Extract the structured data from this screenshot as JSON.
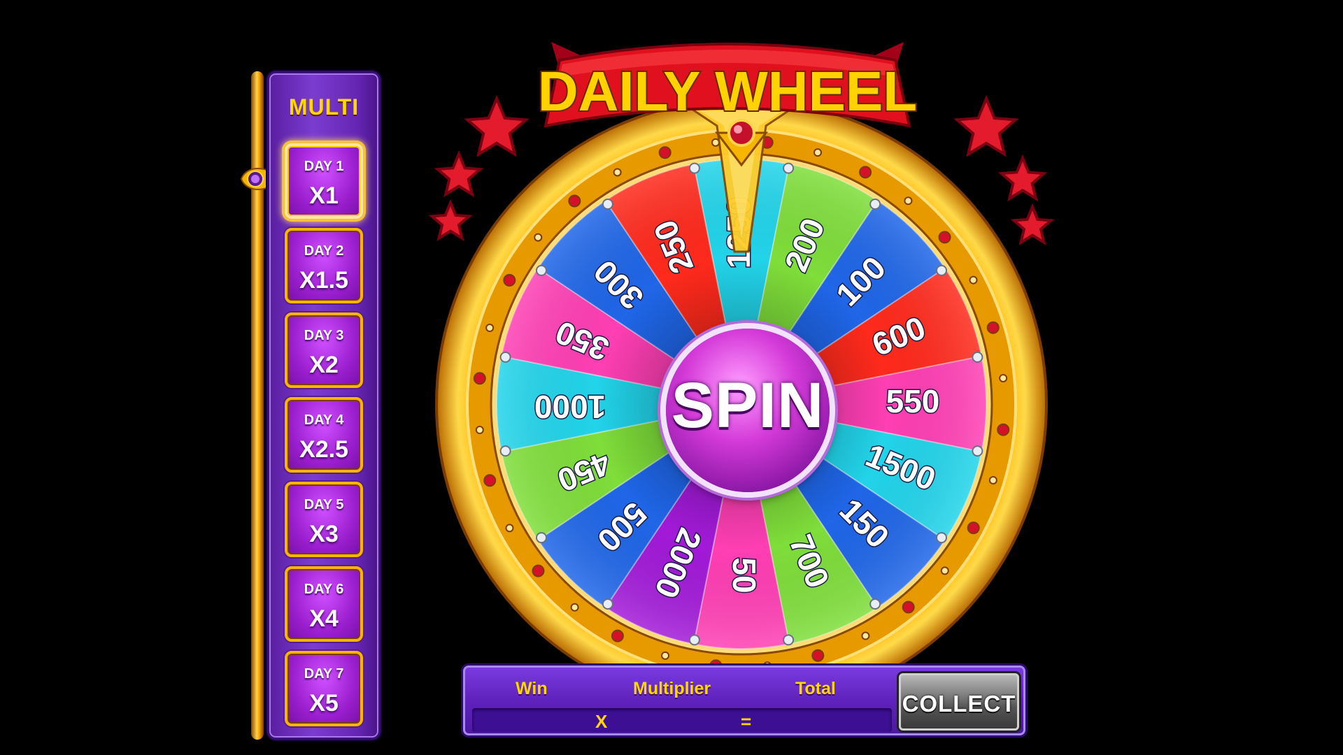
{
  "multi_panel": {
    "title": "MULTI",
    "days": [
      {
        "label": "DAY 1",
        "multiplier": "X1",
        "active": true
      },
      {
        "label": "DAY 2",
        "multiplier": "X1.5",
        "active": false
      },
      {
        "label": "DAY 3",
        "multiplier": "X2",
        "active": false
      },
      {
        "label": "DAY 4",
        "multiplier": "X2.5",
        "active": false
      },
      {
        "label": "DAY 5",
        "multiplier": "X3",
        "active": false
      },
      {
        "label": "DAY 6",
        "multiplier": "X4",
        "active": false
      },
      {
        "label": "DAY 7",
        "multiplier": "X5",
        "active": false
      }
    ]
  },
  "wheel": {
    "title": "DAILY WHEEL",
    "spin_label": "SPIN",
    "segments": [
      {
        "value": "1250",
        "color": "#22d4ea"
      },
      {
        "value": "200",
        "color": "#7fde3a"
      },
      {
        "value": "100",
        "color": "#1f66e8"
      },
      {
        "value": "600",
        "color": "#ff2a1c"
      },
      {
        "value": "550",
        "color": "#ff3fb4"
      },
      {
        "value": "1500",
        "color": "#22d4ea"
      },
      {
        "value": "150",
        "color": "#1f66e8"
      },
      {
        "value": "700",
        "color": "#7fde3a"
      },
      {
        "value": "50",
        "color": "#ff3fb4"
      },
      {
        "value": "2000",
        "color": "#a21ad8"
      },
      {
        "value": "500",
        "color": "#1f66e8"
      },
      {
        "value": "450",
        "color": "#7fde3a"
      },
      {
        "value": "1000",
        "color": "#22d4ea"
      },
      {
        "value": "350",
        "color": "#ff3fb4"
      },
      {
        "value": "300",
        "color": "#1f66e8"
      },
      {
        "value": "250",
        "color": "#ff2a1c"
      }
    ]
  },
  "result_bar": {
    "win_label": "Win",
    "multiplier_label": "Multiplier",
    "total_label": "Total",
    "times_sign": "X",
    "equals_sign": "=",
    "collect_label": "COLLECT"
  }
}
